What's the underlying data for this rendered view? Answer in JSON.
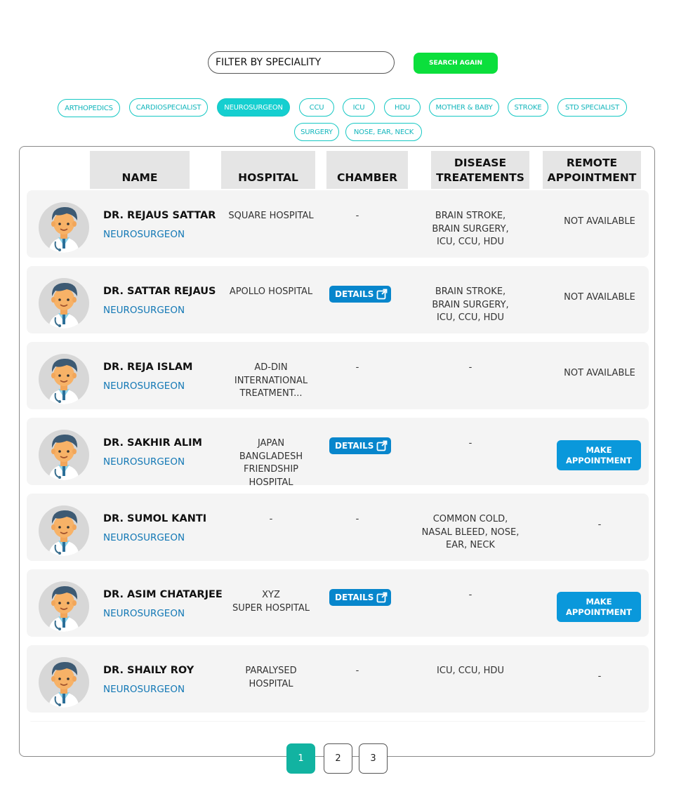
{
  "filter": {
    "placeholder": "FILTER BY SPECIALITY",
    "search_label": "SEARCH AGAIN"
  },
  "chips": [
    "ARTHOPEDICS",
    "CARDIOSPECIALIST",
    "NEUROSURGEON",
    "CCU",
    "ICU",
    "HDU",
    "MOTHER & BABY",
    "STROKE",
    "STD SPECIALIST",
    "SURGERY",
    "NOSE, EAR, NECK"
  ],
  "active_chip": "NEUROSURGEON",
  "table": {
    "headers": {
      "name": "NAME",
      "hospital": "HOSPITAL",
      "chamber": "CHAMBER",
      "disease": "DISEASE\nTREATEMENTS",
      "remote": "REMOTE\nAPPOINTMENT"
    },
    "details_label": "DETAILS",
    "appointment_label": "MAKE\nAPPOINTMENT",
    "rows": [
      {
        "name": "DR. REJAUS SATTAR",
        "speciality": "NEUROSURGEON",
        "hospital": "SQUARE HOSPITAL",
        "chamber": "-",
        "disease": "BRAIN STROKE,\nBRAIN SURGERY,\nICU, CCU, HDU",
        "remote": "NOT AVAILABLE"
      },
      {
        "name": "DR. SATTAR REJAUS",
        "speciality": "NEUROSURGEON",
        "hospital": "APOLLO HOSPITAL",
        "chamber": "DETAILS",
        "disease": "BRAIN STROKE,\nBRAIN SURGERY,\nICU, CCU, HDU",
        "remote": "NOT AVAILABLE"
      },
      {
        "name": "DR. REJA ISLAM",
        "speciality": "NEUROSURGEON",
        "hospital": "AD-DIN\nINTERNATIONAL\nTREATMENT...",
        "chamber": "-",
        "disease": "-",
        "remote": "NOT AVAILABLE"
      },
      {
        "name": "DR. SAKHIR ALIM",
        "speciality": "NEUROSURGEON",
        "hospital": "JAPAN\nBANGLADESH\nFRIENDSHIP\nHOSPITAL",
        "chamber": "DETAILS",
        "disease": "-",
        "remote": "MAKE APPOINTMENT"
      },
      {
        "name": "DR. SUMOL KANTI",
        "speciality": "NEUROSURGEON",
        "hospital": "-",
        "chamber": "-",
        "disease": "COMMON COLD,\nNASAL BLEED, NOSE,\nEAR, NECK",
        "remote": "-"
      },
      {
        "name": "DR. ASIM CHATARJEE",
        "speciality": "NEUROSURGEON",
        "hospital": "XYZ\nSUPER HOSPITAL",
        "chamber": "DETAILS",
        "disease": "-",
        "remote": "MAKE APPOINTMENT"
      },
      {
        "name": "DR. SHAILY ROY",
        "speciality": "NEUROSURGEON",
        "hospital": "PARALYSED\nHOSPITAL",
        "chamber": "-",
        "disease": "ICU, CCU, HDU",
        "remote": "-"
      }
    ]
  },
  "pagination": {
    "pages": [
      "1",
      "2",
      "3"
    ],
    "current": "1"
  },
  "colors": {
    "accent_green": "#0bdf3c",
    "chip_teal": "#15cfd0",
    "details_blue": "#0786cc",
    "appointment_blue": "#0a98db",
    "speciality_blue": "#1378b5",
    "page_active": "#12b3a1"
  }
}
